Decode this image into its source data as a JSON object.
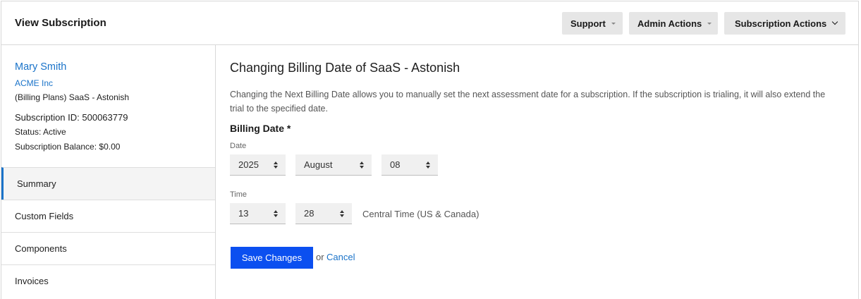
{
  "header": {
    "title": "View Subscription",
    "support_label": "Support",
    "admin_actions_label": "Admin Actions",
    "subscription_actions_label": "Subscription Actions"
  },
  "sidebar": {
    "customer_name": "Mary Smith",
    "organization": "ACME Inc",
    "plan": "(Billing Plans) SaaS - Astonish",
    "subscription_id": "Subscription ID: 500063779",
    "status": "Status: Active",
    "balance": "Subscription Balance: $0.00",
    "nav": [
      {
        "label": "Summary",
        "active": true
      },
      {
        "label": "Custom Fields",
        "active": false
      },
      {
        "label": "Components",
        "active": false
      },
      {
        "label": "Invoices",
        "active": false
      }
    ]
  },
  "main": {
    "title": "Changing Billing Date of SaaS - Astonish",
    "description": "Changing the Next Billing Date allows you to manually set the next assessment date for a subscription. If the subscription is trialing, it will also extend the trial to the specified date.",
    "section_title": "Billing Date *",
    "date_label": "Date",
    "year": "2025",
    "month": "August",
    "day": "08",
    "time_label": "Time",
    "hour": "13",
    "minute": "28",
    "timezone": "Central Time (US & Canada)",
    "save_label": "Save Changes",
    "or_text": "or",
    "cancel_label": "Cancel"
  },
  "colors": {
    "link": "#1a73c9",
    "primary_button": "#0b4ff0",
    "header_button_bg": "#e6e6e6",
    "active_nav_bg": "#f4f4f4"
  }
}
